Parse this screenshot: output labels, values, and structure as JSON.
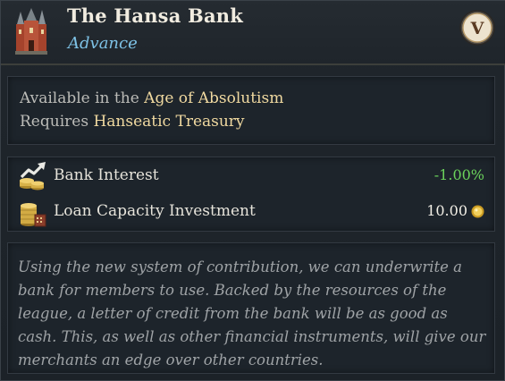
{
  "header": {
    "title": "The Hansa Bank",
    "subtitle": "Advance",
    "age_badge": "V",
    "building_icon": "hanseatic-building-icon"
  },
  "requirements": {
    "line1_prefix": "Available in the",
    "line1_value": "Age of Absolutism",
    "line2_prefix": "Requires",
    "line2_value": "Hanseatic Treasury"
  },
  "modifiers": [
    {
      "icon": "bank-interest-icon",
      "label": "Bank Interest",
      "value": "-1.00%",
      "color": "#6bd25b"
    },
    {
      "icon": "loan-capacity-icon",
      "label": "Loan Capacity Investment",
      "value": "10.00",
      "unit_icon": "gold-coin-icon",
      "color": "#f2efe6"
    }
  ],
  "description": "Using the new system of contribution, we can underwrite a bank for members to use. Backed by the resources of the league, a letter of credit from the bank will be as good as cash. This, as well as other financial instruments, will give our merchants an edge over other countries.",
  "colors": {
    "background": "#1c2228",
    "title": "#f1ece0",
    "subtitle": "#7ec2e6",
    "highlight": "#f0d9a0",
    "positive_modifier": "#6bd25b",
    "description": "#9fa3a6"
  }
}
